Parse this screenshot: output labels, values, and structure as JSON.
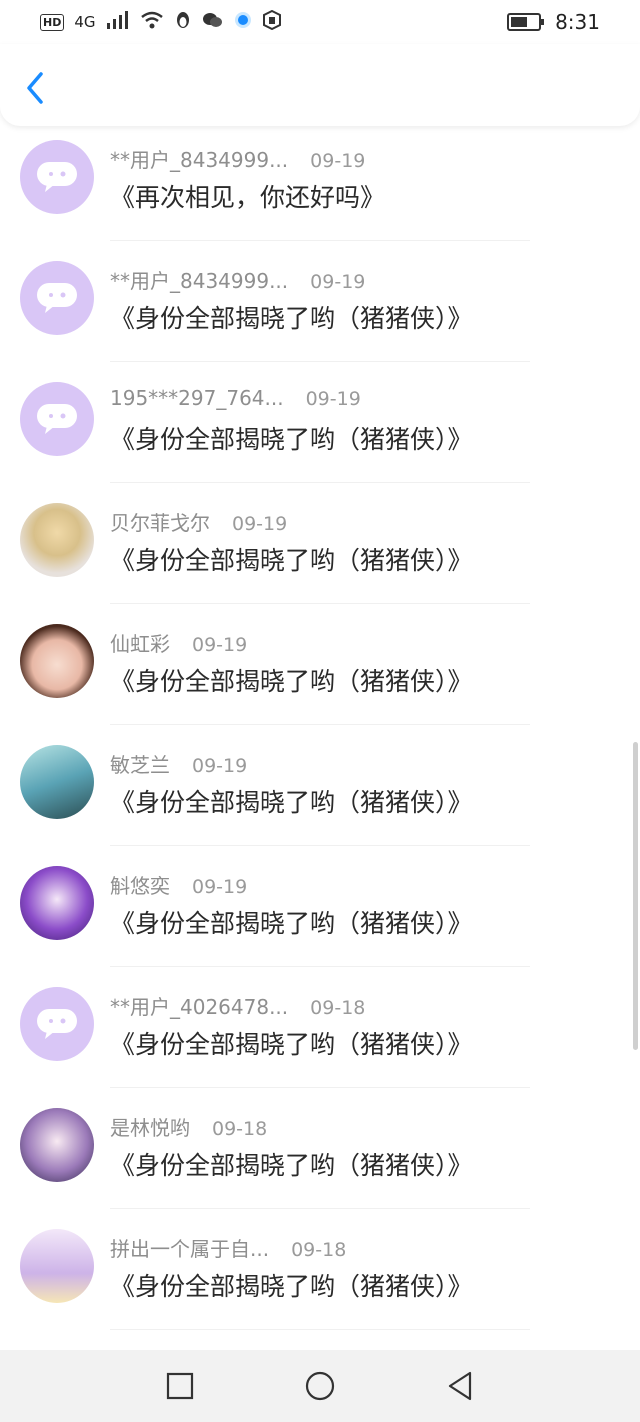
{
  "status_bar": {
    "left_icons": [
      "hd-badge",
      "4g-signal",
      "signal-bars",
      "wifi",
      "penguin-icon",
      "wechat-icon",
      "blue-dot-icon",
      "shield-icon"
    ],
    "hd": "HD",
    "net": "4G",
    "time": "8:31"
  },
  "header": {
    "back_icon": "chevron-left-icon"
  },
  "list": [
    {
      "name": "**用户_8434999...",
      "date": "09-19",
      "title": "《再次相见，你还好吗》",
      "avatar": "default"
    },
    {
      "name": "**用户_8434999...",
      "date": "09-19",
      "title": "《身份全部揭晓了哟（猪猪侠）》",
      "avatar": "default"
    },
    {
      "name": "195***297_764...",
      "date": "09-19",
      "title": "《身份全部揭晓了哟（猪猪侠）》",
      "avatar": "default"
    },
    {
      "name": "贝尔菲戈尔",
      "date": "09-19",
      "title": "《身份全部揭晓了哟（猪猪侠）》",
      "avatar": "photo1"
    },
    {
      "name": "仙虹彩",
      "date": "09-19",
      "title": "《身份全部揭晓了哟（猪猪侠）》",
      "avatar": "photo2"
    },
    {
      "name": "敏芝兰",
      "date": "09-19",
      "title": "《身份全部揭晓了哟（猪猪侠）》",
      "avatar": "photo3"
    },
    {
      "name": "斛悠奕",
      "date": "09-19",
      "title": "《身份全部揭晓了哟（猪猪侠）》",
      "avatar": "photo4"
    },
    {
      "name": "**用户_4026478...",
      "date": "09-18",
      "title": "《身份全部揭晓了哟（猪猪侠）》",
      "avatar": "default"
    },
    {
      "name": "是林悦哟",
      "date": "09-18",
      "title": "《身份全部揭晓了哟（猪猪侠）》",
      "avatar": "photo5"
    },
    {
      "name": "拼出一个属于自...",
      "date": "09-18",
      "title": "《身份全部揭晓了哟（猪猪侠）》",
      "avatar": "photo6"
    }
  ],
  "colors": {
    "accent": "#1a8cff",
    "avatar_default_bg": "#d9c6f6",
    "name_color": "#8e8e8e",
    "title_color": "#2a2a2a"
  },
  "navbar": {
    "icons": [
      "square-recent-apps-icon",
      "circle-home-icon",
      "triangle-back-icon"
    ]
  }
}
